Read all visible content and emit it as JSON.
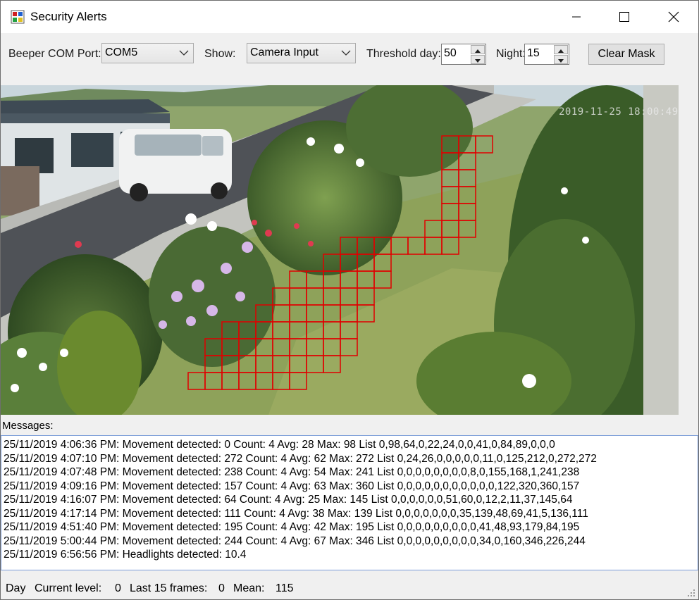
{
  "window": {
    "title": "Security Alerts"
  },
  "toolbar": {
    "com_label": "Beeper COM Port:",
    "com_value": "COM5",
    "show_label": "Show:",
    "show_value": "Camera Input",
    "threshold_day_label": "Threshold day:",
    "threshold_day_value": "50",
    "night_label": "Night:",
    "night_value": "15",
    "clear_mask_label": "Clear Mask"
  },
  "camera": {
    "timestamp": "2019-11-25 18:00:49",
    "mask_color": "#e00000"
  },
  "messages": {
    "label": "Messages:",
    "lines": [
      "25/11/2019 4:06:36 PM: Movement detected: 0 Count: 4 Avg: 28 Max: 98 List 0,98,64,0,22,24,0,0,41,0,84,89,0,0,0",
      "25/11/2019 4:07:10 PM: Movement detected: 272 Count: 4 Avg: 62 Max: 272 List 0,24,26,0,0,0,0,0,11,0,125,212,0,272,272",
      "25/11/2019 4:07:48 PM: Movement detected: 238 Count: 4 Avg: 54 Max: 241 List 0,0,0,0,0,0,0,0,8,0,155,168,1,241,238",
      "25/11/2019 4:09:16 PM: Movement detected: 157 Count: 4 Avg: 63 Max: 360 List 0,0,0,0,0,0,0,0,0,0,0,122,320,360,157",
      "25/11/2019 4:16:07 PM: Movement detected: 64 Count: 4 Avg: 25 Max: 145 List 0,0,0,0,0,0,51,60,0,12,2,11,37,145,64",
      "25/11/2019 4:17:14 PM: Movement detected: 111 Count: 4 Avg: 38 Max: 139 List 0,0,0,0,0,0,0,35,139,48,69,41,5,136,111",
      "25/11/2019 4:51:40 PM: Movement detected: 195 Count: 4 Avg: 42 Max: 195 List 0,0,0,0,0,0,0,0,0,41,48,93,179,84,195",
      "25/11/2019 5:00:44 PM: Movement detected: 244 Count: 4 Avg: 67 Max: 346 List 0,0,0,0,0,0,0,0,0,34,0,160,346,226,244",
      "25/11/2019 6:56:56 PM: Headlights detected: 10.4"
    ]
  },
  "status": {
    "mode": "Day",
    "current_level_label": "Current level:",
    "current_level_value": "0",
    "last_frames_label": "Last 15 frames:",
    "last_frames_value": "0",
    "mean_label": "Mean:",
    "mean_value": "115"
  },
  "icons": {
    "app": "app-icon",
    "minimize": "minimize-icon",
    "maximize": "maximize-icon",
    "close": "close-icon",
    "dropdown": "chevron-down-icon",
    "spin_up": "spin-up-icon",
    "spin_down": "spin-down-icon",
    "grip": "resize-grip-icon"
  }
}
